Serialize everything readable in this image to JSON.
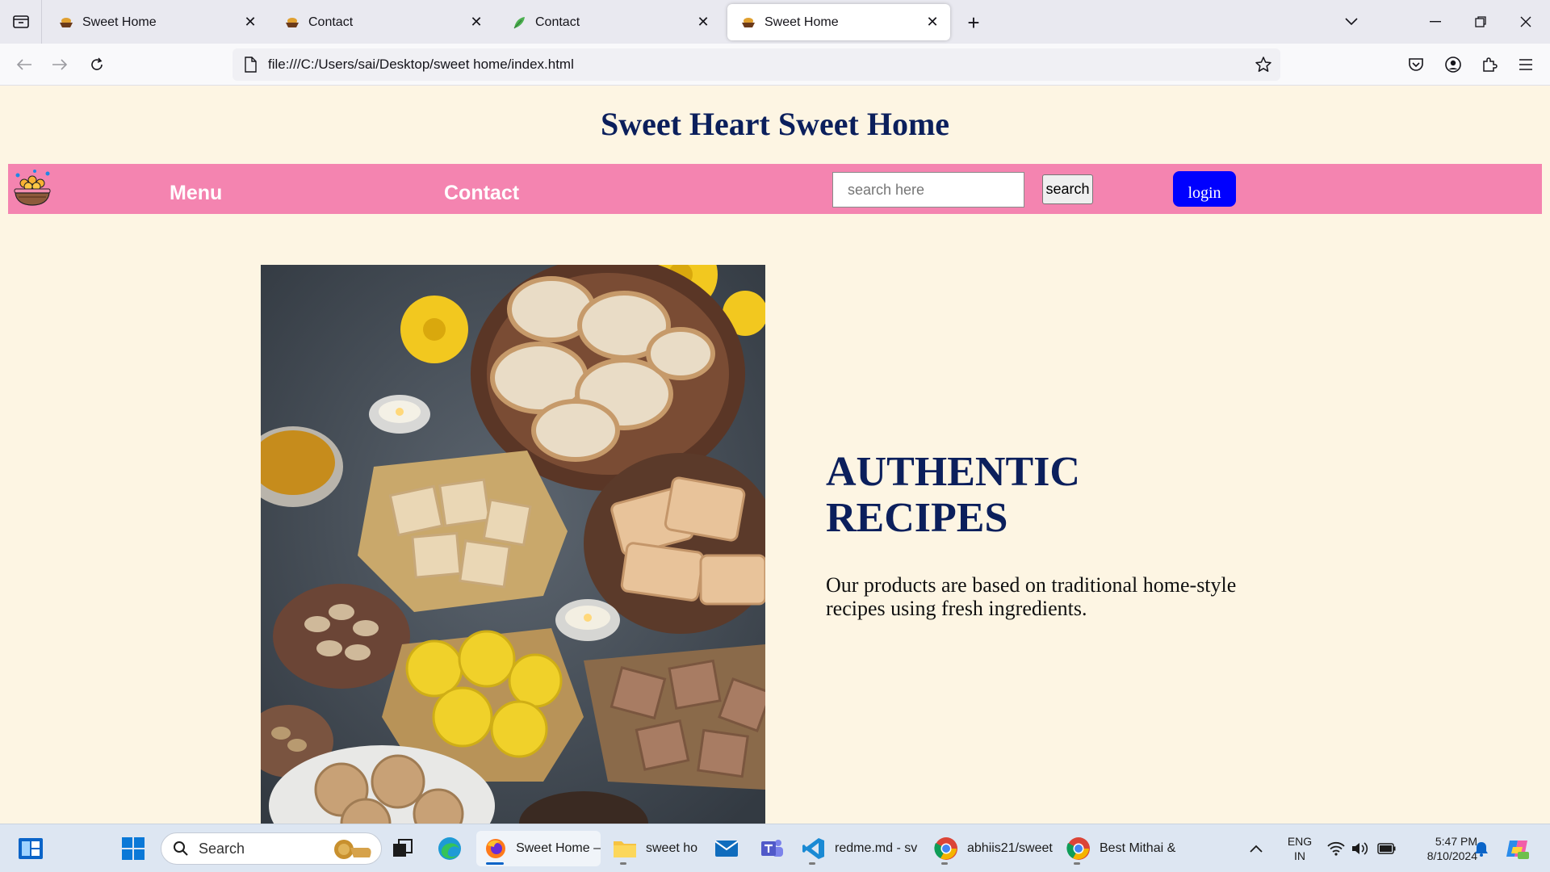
{
  "browser": {
    "tabs": [
      {
        "title": "Sweet Home",
        "favicon": "sweets-bowl-icon",
        "active": false
      },
      {
        "title": "Contact",
        "favicon": "sweets-bowl-icon",
        "active": false
      },
      {
        "title": "Contact",
        "favicon": "leaf-icon",
        "active": false
      },
      {
        "title": "Sweet Home",
        "favicon": "sweets-bowl-icon",
        "active": true
      }
    ],
    "url": "file:///C:/Users/sai/Desktop/sweet home/index.html"
  },
  "site": {
    "title": "Sweet Heart Sweet Home",
    "nav": {
      "menu_label": "Menu",
      "contact_label": "Contact",
      "search_placeholder": "search here",
      "search_button": "search",
      "login_button": "login"
    },
    "hero": {
      "heading_line1": "AUTHENTIC",
      "heading_line2": "RECIPES",
      "text": "Our products are based on traditional home-style recipes using fresh ingredients."
    }
  },
  "taskbar": {
    "search_placeholder": "Search",
    "apps": [
      {
        "label": "Sweet Home –",
        "icon": "firefox-icon",
        "active": true
      },
      {
        "label": "sweet ho",
        "icon": "folder-icon"
      },
      {
        "label": "",
        "icon": "mail-icon"
      },
      {
        "label": "",
        "icon": "teams-icon"
      },
      {
        "label": "redme.md - sv",
        "icon": "vscode-icon"
      },
      {
        "label": "abhiis21/sweet",
        "icon": "chrome-icon"
      },
      {
        "label": "Best Mithai &",
        "icon": "chrome-icon"
      }
    ],
    "tray": {
      "lang_line1": "ENG",
      "lang_line2": "IN",
      "time": "5:47 PM",
      "date": "8/10/2024"
    }
  },
  "colors": {
    "page_bg": "#fdf5e3",
    "title_navy": "#0b1f5c",
    "nav_pink": "#f484b0",
    "login_blue": "#0000ff"
  }
}
